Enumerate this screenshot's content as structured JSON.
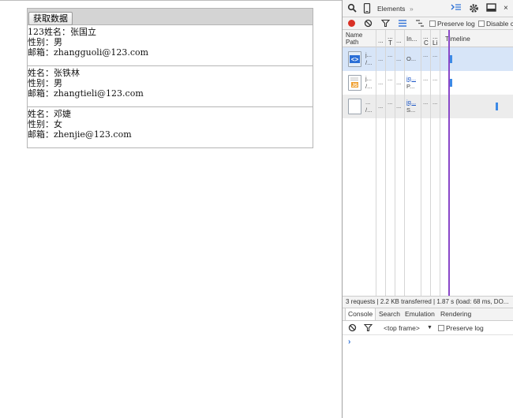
{
  "page": {
    "fetch_button": "获取数据",
    "records": [
      {
        "name_line": "123姓名：张国立",
        "gender_line": "性别：男",
        "email_line": "邮箱：zhangguoli@123.com"
      },
      {
        "name_line": "姓名：张铁林",
        "gender_line": "性别：男",
        "email_line": "邮箱：zhangtieli@123.com"
      },
      {
        "name_line": "姓名：邓婕",
        "gender_line": "性别：女",
        "email_line": "邮箱：zhenjie@123.com"
      }
    ]
  },
  "devtools": {
    "toolbar": {
      "elements_tab": "Elements",
      "more": "»",
      "close": "×"
    },
    "network": {
      "preserve_log": "Preserve log",
      "disable_cache": "Disable c"
    },
    "columns": {
      "name": "Name",
      "path": "Path",
      "dots": "...",
      "t": "T",
      "initiator": "In...",
      "c": "C",
      "l": "Li",
      "timeline": "Timeline"
    },
    "requests": [
      {
        "name": "j...",
        "path": "/...",
        "type": "...",
        "initiator": "O...",
        "size": "...",
        "time": "..."
      },
      {
        "name": "j...",
        "path": "/...",
        "type": "...",
        "initiator": "jq...",
        "initiator2": "P...",
        "size": "...",
        "time": "..."
      },
      {
        "name": "...",
        "path": "/...",
        "type": "...",
        "initiator": "jq...",
        "initiator2": "S...",
        "size": "...",
        "time": "..."
      }
    ],
    "status": "3 requests | 2.2 KB transferred | 1.87 s (load: 68 ms, DO...",
    "drawer_tabs": [
      "Console",
      "Search",
      "Emulation",
      "Rendering"
    ],
    "console": {
      "frame": "<top frame>",
      "dropdown": "▼",
      "preserve_log": "Preserve log",
      "prompt": "›"
    }
  }
}
